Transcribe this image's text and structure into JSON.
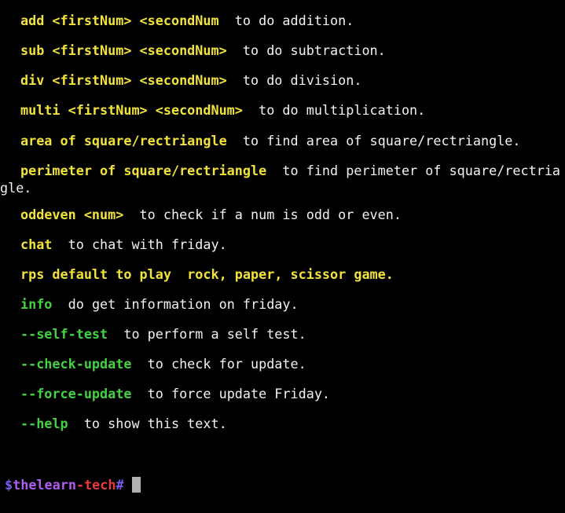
{
  "window": {
    "title": ""
  },
  "colors": {
    "background": "#000000",
    "text": "#f2f2f2",
    "command_yellow": "#f2e33a",
    "command_green": "#44d142",
    "prompt_purple": "#b25cf0",
    "prompt_red": "#e83a3a",
    "cursor": "#b0b0b0"
  },
  "help": {
    "add": {
      "cmd": "add <firstNum> <secondNum",
      "desc": "  to do addition."
    },
    "sub": {
      "cmd": "sub <firstNum> <secondNum>",
      "desc": "  to do subtraction."
    },
    "div": {
      "cmd": "div <firstNum> <secondNum>",
      "desc": "  to do division."
    },
    "multi": {
      "cmd": "multi <firstNum> <secondNum>",
      "desc": "  to do multiplication."
    },
    "area": {
      "cmd": "area of square/rectriangle",
      "desc": "  to find area of square/rectriangle."
    },
    "perimeter": {
      "cmd": "perimeter of square/rectriangle",
      "desc": "  to find perimeter of square/rectria\ngle."
    },
    "oddeven": {
      "cmd": "oddeven <num>",
      "desc": "  to check if a num is odd or even."
    },
    "chat": {
      "cmd": "chat",
      "desc": "  to chat with friday."
    },
    "rps": {
      "cmd": "rps default to play",
      "desc": "  rock, paper, scissor game."
    },
    "info": {
      "cmd": "info",
      "desc": "  do get information on friday."
    },
    "self_test": {
      "cmd": "--self-test",
      "desc": "  to perform a self test."
    },
    "check_update": {
      "cmd": "--check-update",
      "desc": "  to check for update."
    },
    "force_update": {
      "cmd": "--force-update",
      "desc": "  to force update Friday."
    },
    "help": {
      "cmd": "--help",
      "desc": "  to show this text."
    }
  },
  "prompt": {
    "dollar": "$",
    "the": "the",
    "learn": "learn",
    "dash": "-",
    "tech": "tech",
    "hash": "#"
  }
}
